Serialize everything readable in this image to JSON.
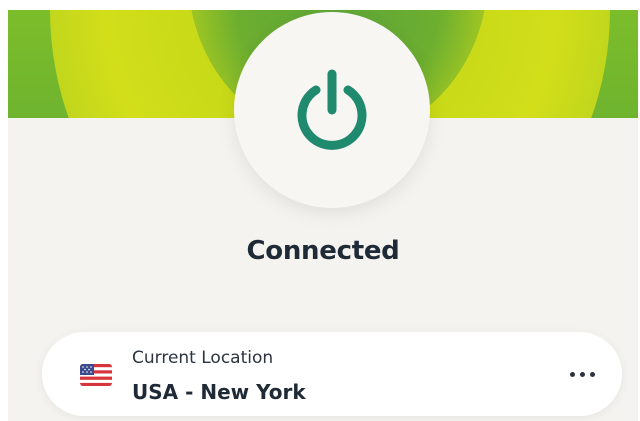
{
  "app": {
    "accent_color": "#1f8a6e",
    "band_color": "#7cbd2a"
  },
  "power": {
    "icon": "power-icon",
    "status_label": "Connected"
  },
  "location": {
    "title": "Current Location",
    "value": "USA - New York",
    "flag_icon": "us-flag-icon",
    "menu_icon": "more-options-icon"
  }
}
